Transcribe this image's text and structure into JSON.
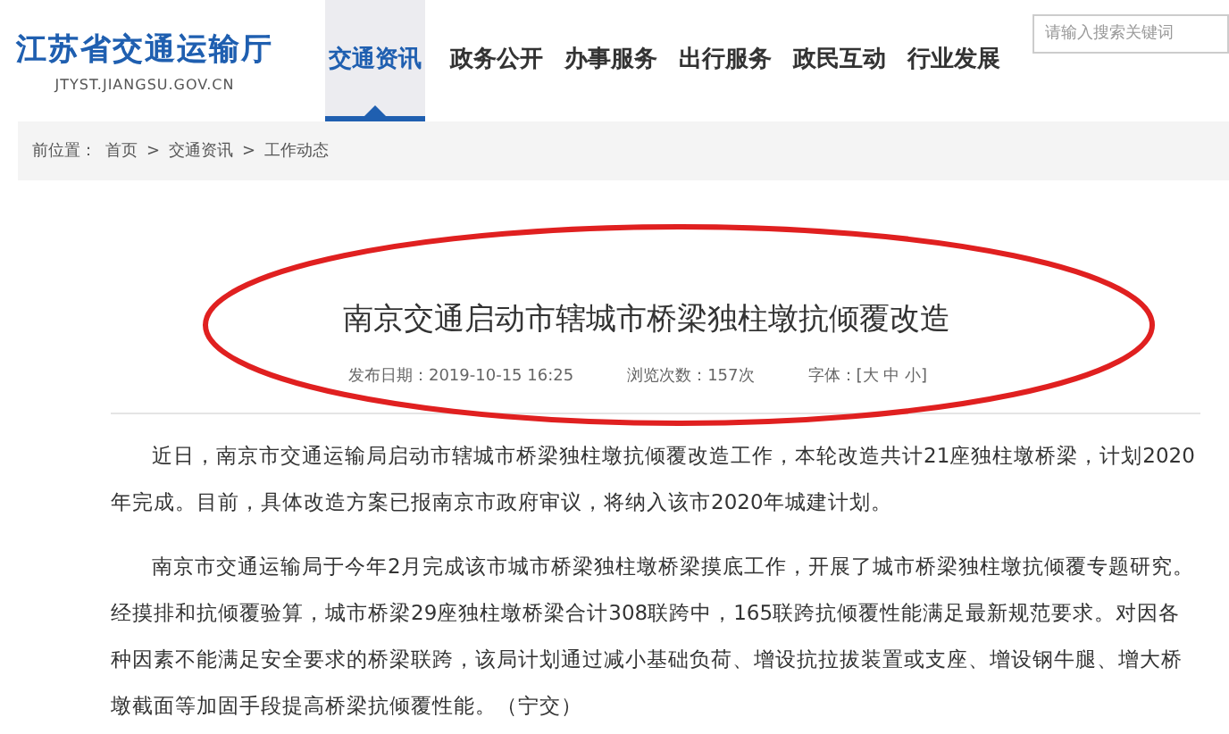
{
  "logo": {
    "name": "江苏省交通运输厅",
    "domain": "JTYST.JIANGSU.GOV.CN"
  },
  "nav": [
    {
      "label": "交通资讯",
      "selected": true
    },
    {
      "label": "政务公开",
      "selected": false
    },
    {
      "label": "办事服务",
      "selected": false
    },
    {
      "label": "出行服务",
      "selected": false
    },
    {
      "label": "政民互动",
      "selected": false
    },
    {
      "label": "行业发展",
      "selected": false
    }
  ],
  "search": {
    "placeholder": "请输入搜索关键词"
  },
  "breadcrumb": {
    "label": "前位置：",
    "items": [
      "首页",
      "交通资讯",
      "工作动态"
    ],
    "separator": ">"
  },
  "article": {
    "title": "南京交通启动市辖城市桥梁独柱墩抗倾覆改造",
    "title_circled": true,
    "meta": [
      "发布日期：2019-10-15 16:25",
      "浏览次数：157次",
      "字体：[大 中 小]"
    ],
    "paragraphs": [
      "近日，南京市交通运输局启动市辖城市桥梁独柱墩抗倾覆改造工作，本轮改造共计21座独柱墩桥梁，计划2020年完成。目前，具体改造方案已报南京市政府审议，将纳入该市2020年城建计划。",
      "南京市交通运输局于今年2月完成该市城市桥梁独柱墩桥梁摸底工作，开展了城市桥梁独柱墩抗倾覆专题研究。经摸排和抗倾覆验算，城市桥梁29座独柱墩桥梁合计308联跨中，165联跨抗倾覆性能满足最新规范要求。对因各种因素不能满足安全要求的桥梁联跨，该局计划通过减小基础负荷、增设抗拉拔装置或支座、增设钢牛腿、增大桥墩截面等加固手段提高桥梁抗倾覆性能。（宁交）"
    ]
  }
}
